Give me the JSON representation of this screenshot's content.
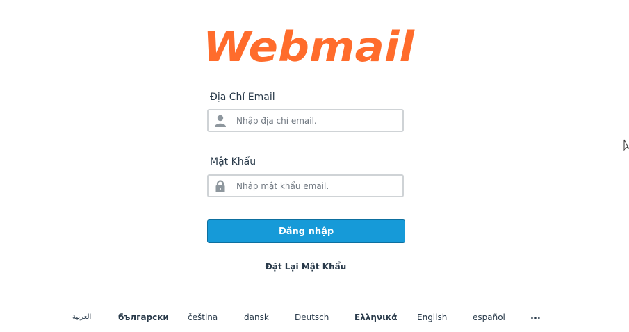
{
  "brand": {
    "logo_text": "Webmail",
    "logo_color": "#ff6c2c"
  },
  "form": {
    "email_label": "Địa Chỉ Email",
    "email_placeholder": "Nhập địa chỉ email.",
    "email_value": "",
    "password_label": "Mật Khẩu",
    "password_placeholder": "Nhập mật khẩu email.",
    "password_value": "",
    "submit_label": "Đăng nhập",
    "reset_link": "Đặt Lại Mật Khẩu"
  },
  "icons": {
    "email_icon": "user-icon",
    "password_icon": "lock-icon"
  },
  "languages": [
    "العربية",
    "български",
    "čeština",
    "dansk",
    "Deutsch",
    "Ελληνικά",
    "English",
    "español"
  ],
  "languages_more": "...",
  "colors": {
    "primary_button": "#169ad8",
    "text": "#293a4a"
  }
}
